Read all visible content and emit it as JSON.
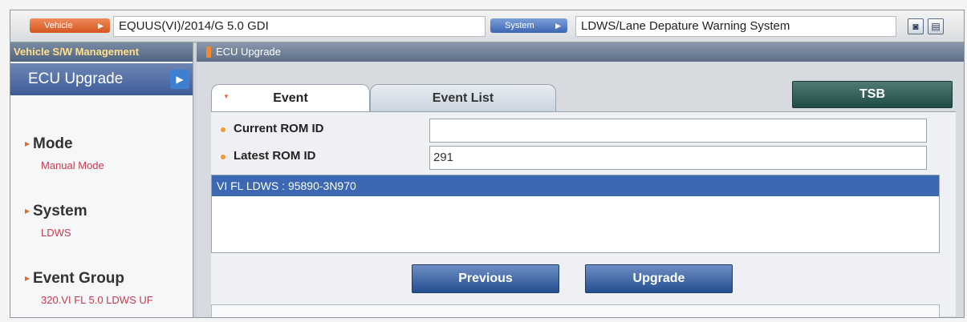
{
  "topbar": {
    "vehicle_label": "Vehicle",
    "vehicle_value": "EQUUS(VI)/2014/G 5.0 GDI",
    "system_label": "System",
    "system_value": "LDWS/Lane Depature Warning System",
    "icons": [
      "camera-icon",
      "print-icon"
    ]
  },
  "sidebar": {
    "header": "Vehicle S/W Management",
    "active_item": "ECU Upgrade",
    "sections": [
      {
        "title": "Mode",
        "value": "Manual Mode"
      },
      {
        "title": "System",
        "value": "LDWS"
      },
      {
        "title": "Event Group",
        "value": "320.VI FL 5.0 LDWS UF"
      }
    ]
  },
  "main": {
    "header": "ECU Upgrade",
    "tabs": [
      {
        "label": "Event",
        "active": true
      },
      {
        "label": "Event List",
        "active": false
      }
    ],
    "tsb_label": "TSB",
    "current_rom_label": "Current ROM ID",
    "current_rom_value": "",
    "latest_rom_label": "Latest ROM ID",
    "latest_rom_value": "291",
    "list_items": [
      "VI FL LDWS : 95890-3N970"
    ],
    "previous_label": "Previous",
    "upgrade_label": "Upgrade"
  },
  "colors": {
    "vehicle_pill": "#d4561e",
    "system_pill": "#3c67b3",
    "selected_row": "#3b67b3",
    "tsb_button": "#1f4c47",
    "action_button": "#234e8e",
    "sidebar_value": "#c9394d"
  }
}
